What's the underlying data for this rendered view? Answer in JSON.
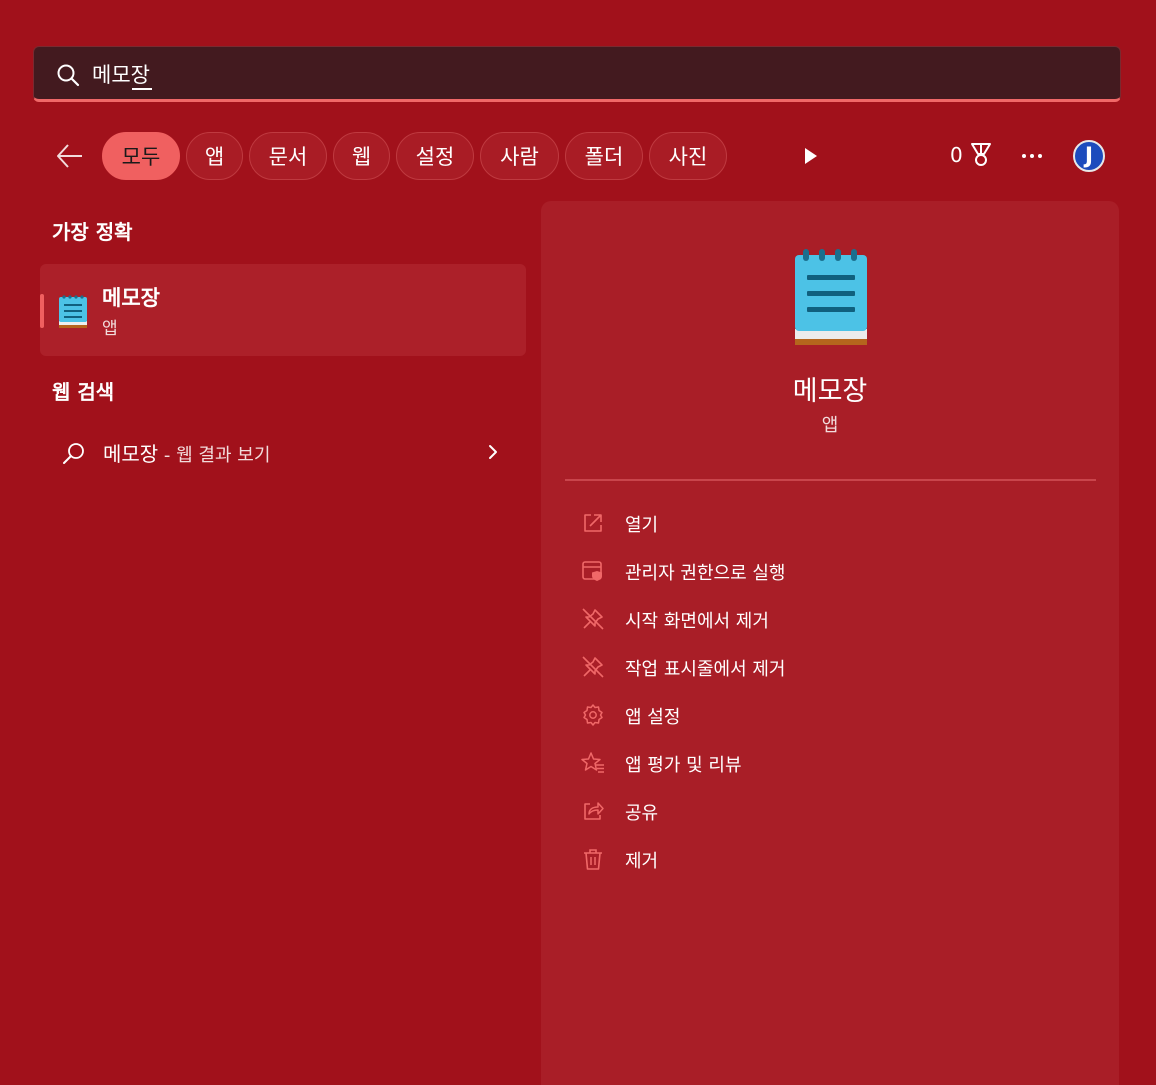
{
  "search": {
    "value": "메모장"
  },
  "filters": [
    {
      "label": "모두",
      "active": true
    },
    {
      "label": "앱"
    },
    {
      "label": "문서"
    },
    {
      "label": "웹"
    },
    {
      "label": "설정"
    },
    {
      "label": "사람"
    },
    {
      "label": "폴더"
    },
    {
      "label": "사진"
    }
  ],
  "toolbar": {
    "points": "0",
    "avatar_initial": "J"
  },
  "best_match": {
    "heading": "가장 정확",
    "name": "메모장",
    "type": "앱"
  },
  "web_search": {
    "heading": "웹 검색",
    "query": "메모장",
    "suffix": " - 웹 결과 보기"
  },
  "detail": {
    "title": "메모장",
    "subtitle": "앱",
    "actions": [
      {
        "label": "열기",
        "icon": "open-icon"
      },
      {
        "label": "관리자 권한으로 실행",
        "icon": "admin-shield-icon"
      },
      {
        "label": "시작 화면에서 제거",
        "icon": "unpin-icon"
      },
      {
        "label": "작업 표시줄에서 제거",
        "icon": "unpin-icon"
      },
      {
        "label": "앱 설정",
        "icon": "gear-icon"
      },
      {
        "label": "앱 평가 및 리뷰",
        "icon": "rate-review-icon"
      },
      {
        "label": "공유",
        "icon": "share-icon"
      },
      {
        "label": "제거",
        "icon": "trash-icon"
      }
    ]
  },
  "colors": {
    "accent": "#f06060",
    "background": "#a1111b",
    "panel": "#a91e27"
  }
}
